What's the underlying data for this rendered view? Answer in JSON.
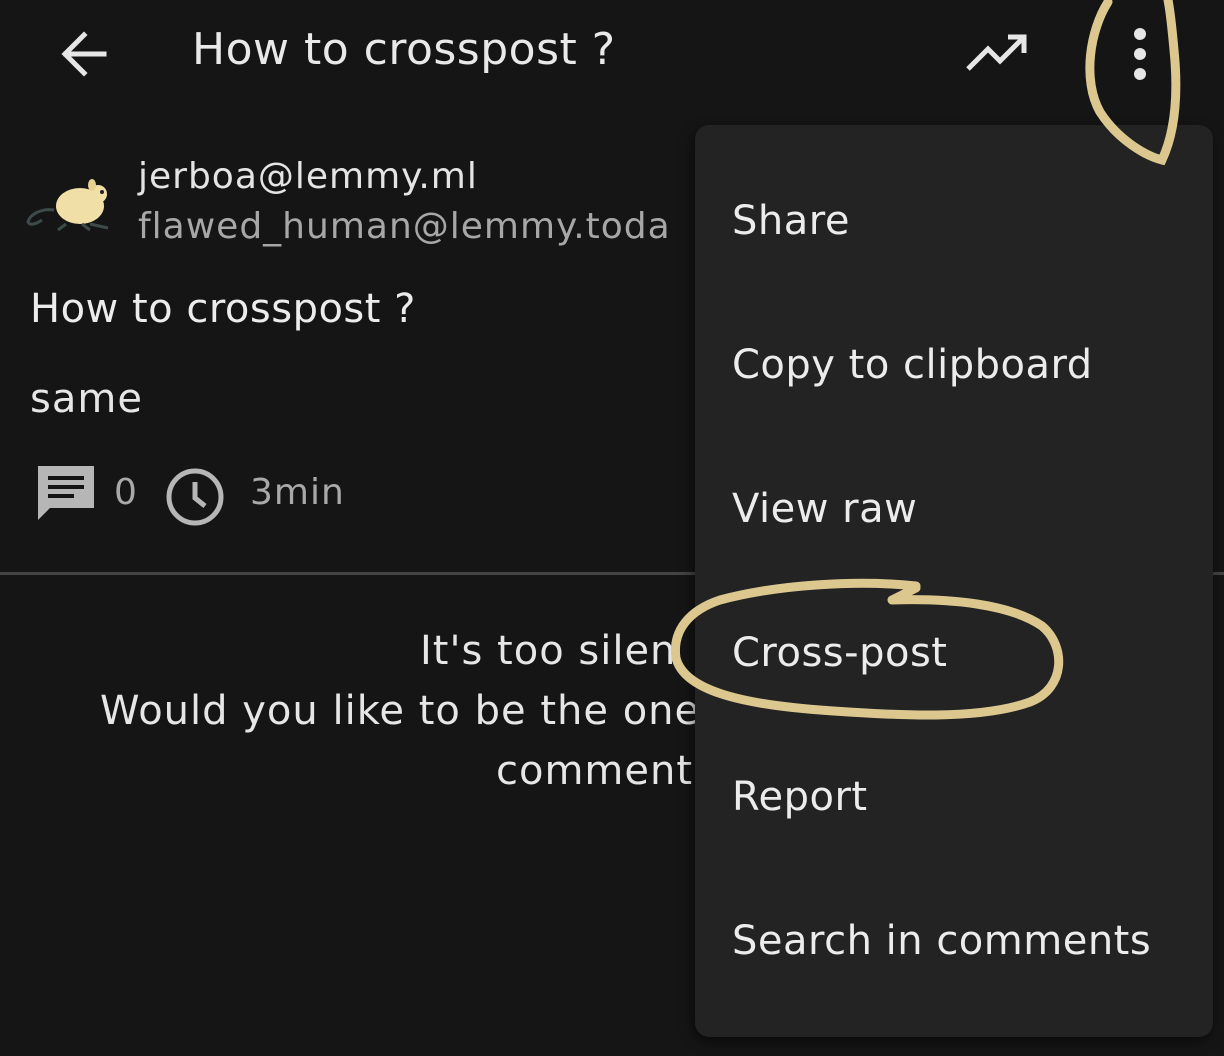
{
  "header": {
    "title": "How to crosspost ?",
    "back_icon": "arrow-left-icon",
    "trend_icon": "trending-up-icon",
    "more_icon": "more-vertical-icon"
  },
  "post": {
    "community": "jerboa@lemmy.ml",
    "author": "flawed_human@lemmy.toda",
    "title": "How to crosspost ?",
    "body": "same",
    "comment_count": "0",
    "age": "3min"
  },
  "empty_state": {
    "line1": "It's too silen",
    "line2": "Would you like to be the one",
    "line3": "comment"
  },
  "menu": {
    "items": [
      {
        "label": "Share"
      },
      {
        "label": "Copy to clipboard"
      },
      {
        "label": "View raw"
      },
      {
        "label": "Cross-post"
      },
      {
        "label": "Report"
      },
      {
        "label": "Search in comments"
      }
    ]
  },
  "colors": {
    "background": "#151515",
    "menu_background": "#232323",
    "annotation": "#dcc78f"
  }
}
